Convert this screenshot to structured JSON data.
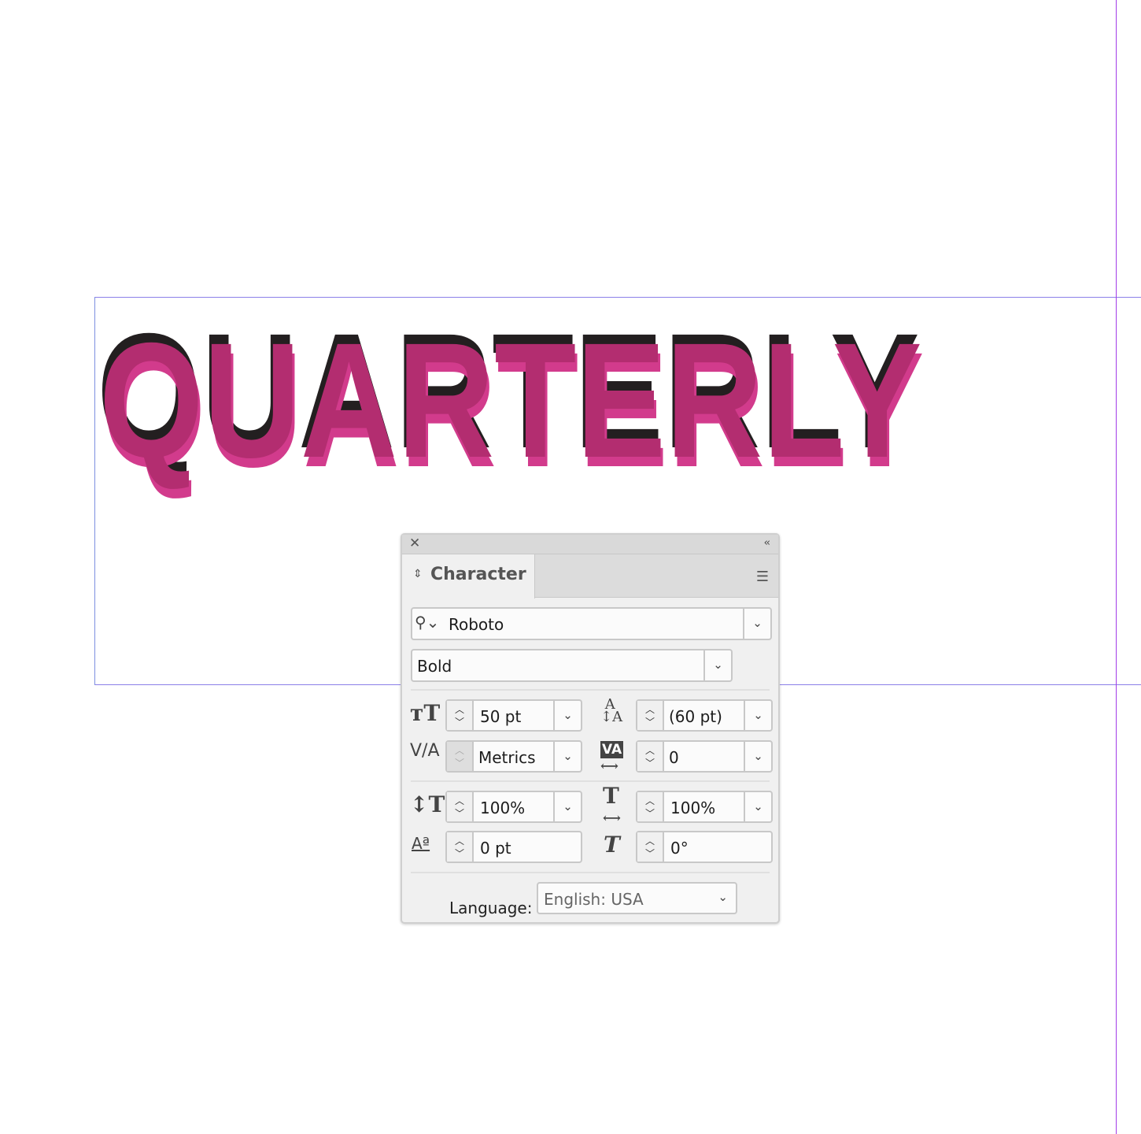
{
  "canvas": {
    "headline": "QUARTERLY",
    "colors": {
      "main": "#b32d70",
      "highlight": "#d23b8c",
      "shadow": "#231f20"
    }
  },
  "panel": {
    "close_icon": "close-icon",
    "collapse_label": "‹‹",
    "tab_label": "Character",
    "font_family": "Roboto",
    "font_style": "Bold",
    "font_size": "50 pt",
    "leading": "(60 pt)",
    "kerning": "Metrics",
    "tracking": "0",
    "vertical_scale": "100%",
    "horizontal_scale": "100%",
    "baseline_shift": "0 pt",
    "skew": "0°",
    "language_label": "Language:",
    "language": "English: USA"
  }
}
